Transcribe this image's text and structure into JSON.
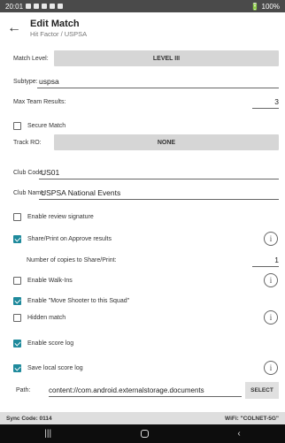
{
  "status_bar": {
    "time": "20:01",
    "battery": "100%"
  },
  "header": {
    "title": "Edit Match",
    "subtitle": "Hit Factor / USPSA"
  },
  "fields": {
    "match_level_label": "Match Level:",
    "match_level_value": "LEVEL III",
    "subtype_label": "Subtype:",
    "subtype_value": "uspsa",
    "max_team_label": "Max Team Results:",
    "max_team_value": "3",
    "secure_match_label": "Secure Match",
    "track_ro_label": "Track RO:",
    "track_ro_value": "NONE",
    "club_code_label": "Club Code:",
    "club_code_value": "US01",
    "club_name_label": "Club Name:",
    "club_name_value": "USPSA National Events",
    "copies_label": "Number of copies to Share/Print:",
    "copies_value": "1",
    "path_label": "Path:",
    "path_value": "content://com.android.externalstorage.documents",
    "select_label": "SELECT"
  },
  "options": {
    "secure_match": false,
    "review_signature": {
      "label": "Enable review signature",
      "checked": false
    },
    "share_print": {
      "label": "Share/Print on Approve results",
      "checked": true
    },
    "walk_ins": {
      "label": "Enable Walk-Ins",
      "checked": false
    },
    "move_shooter": {
      "label": "Enable \"Move Shooter to this Squad\"",
      "checked": true
    },
    "hidden_match": {
      "label": "Hidden match",
      "checked": false
    },
    "score_log": {
      "label": "Enable score log",
      "checked": true
    },
    "save_local": {
      "label": "Save local score log",
      "checked": true
    }
  },
  "footer": {
    "sync_code": "Sync Code: 0114",
    "wifi": "WiFi: \"COLNET-5G\""
  },
  "icons": {
    "back": "arrow-left-icon",
    "info": "info-circle-icon"
  },
  "colors": {
    "accent": "#1f8a9c",
    "button_gray": "#d6d6d6"
  }
}
